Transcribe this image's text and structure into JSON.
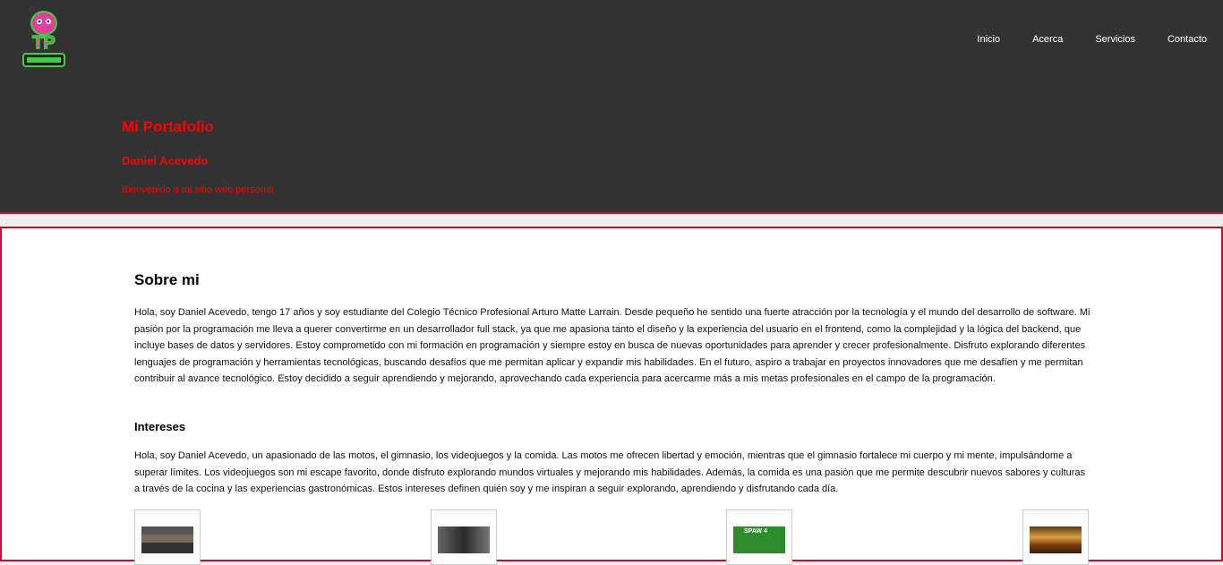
{
  "logo": {
    "icon": "tp-monster-logo",
    "text": "TP"
  },
  "nav": {
    "items": [
      "Inicio",
      "Acerca",
      "Servicios",
      "Contacto"
    ]
  },
  "hero": {
    "title": "Mi Portafolio",
    "name": "Daniel Acevedo",
    "subtitle": "Bienvenido a mi sitio web personal"
  },
  "about": {
    "title": "Sobre mi",
    "text": "Hola, soy Daniel Acevedo, tengo 17 años y soy estudiante del Colegio Técnico Profesional Arturo Matte Larrain. Desde pequeño he sentido una fuerte atracción por la tecnología y el mundo del desarrollo de software. Mi pasión por la programación me lleva a querer convertirme en un desarrollador full stack, ya que me apasiona tanto el diseño y la experiencia del usuario en el frontend, como la complejidad y la lógica del backend, que incluye bases de datos y servidores. Estoy comprometido con mi formación en programación y siempre estoy en busca de nuevas oportunidades para aprender y crecer profesionalmente. Disfruto explorando diferentes lenguajes de programación y herramientas tecnológicas, buscando desafíos que me permitan aplicar y expandir mis habilidades. En el futuro, aspiro a trabajar en proyectos innovadores que me desafíen y me permitan contribuir al avance tecnológico. Estoy decidido a seguir aprendiendo y mejorando, aprovechando cada experiencia para acercarme más a mis metas profesionales en el campo de la programación."
  },
  "interests": {
    "title": "Intereses",
    "text": "Hola, soy Daniel Acevedo, un apasionado de las motos, el gimnasio, los videojuegos y la comida. Las motos me ofrecen libertad y emoción, mientras que el gimnasio fortalece mi cuerpo y mi mente, impulsándome a superar límites. Los videojuegos son mi escape favorito, donde disfruto explorando mundos virtuales y mejorando mis habilidades. Además, la comida es una pasión que me permite descubrir nuevos sabores y culturas a través de la cocina y las experiencias gastronómicas. Estos intereses definen quién soy y me inspiran a seguir explorando, aprendiendo y disfrutando cada día.",
    "cards": [
      {
        "icon": "gym-photo"
      },
      {
        "icon": "motorcycle-photo"
      },
      {
        "icon": "videogame-photo",
        "caption": "SPAW 4"
      },
      {
        "icon": "burger-photo"
      }
    ]
  },
  "colors": {
    "accent": "#ff0000",
    "border": "#c8102e",
    "header_bg": "#333333"
  }
}
